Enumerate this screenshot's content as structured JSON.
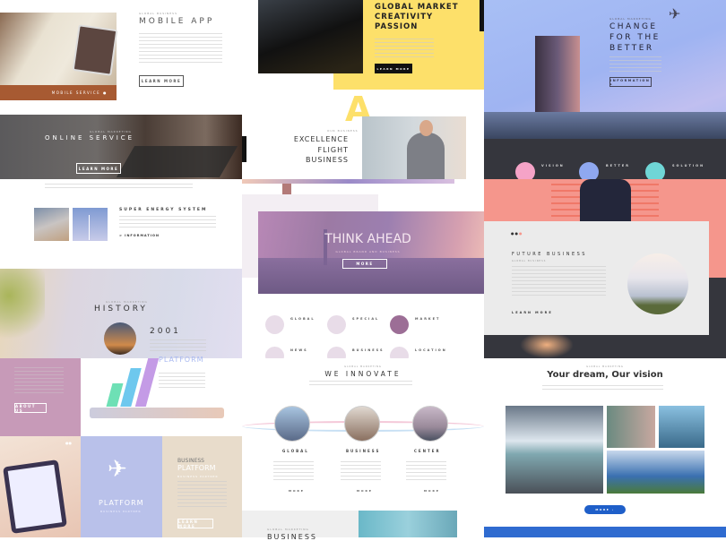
{
  "mobile_app": {
    "kicker": "GLOBAL BUSINESS",
    "title": "MOBILE APP",
    "button": "LEARN MORE",
    "bar_label": "MOBILE SERVICE",
    "bar_color": "#a75a32"
  },
  "online_service": {
    "kicker": "GLOBAL MARKETING",
    "title": "ONLINE SERVICE",
    "button": "LEARN MORE"
  },
  "energy": {
    "title": "SUPER ENERGY SYSTEM",
    "link": "> INFORMATION"
  },
  "history": {
    "kicker": "GLOBAL MARKETING",
    "title": "HISTORY",
    "year": "2001"
  },
  "about": {
    "button": "ABOUT US",
    "color": "#c79ab8"
  },
  "platform_chart": {
    "title": "PLATFORM"
  },
  "platform_plane": {
    "title": "PLATFORM",
    "subtitle": "BUSINESS PARTNER",
    "color": "#b9c1ea"
  },
  "business_platform": {
    "line1": "BUSINESS",
    "line2": "PLATFORM",
    "subtitle": "BUSINESS PARTNER",
    "button": "LEARN MORE",
    "color": "#e8dccb"
  },
  "global_market": {
    "lines": [
      "GLOBAL MARKET",
      "CREATIVITY",
      "PASSION"
    ],
    "button": "LEARN MORE",
    "color": "#fde06a"
  },
  "excellence": {
    "letter": "A",
    "kicker": "OUR BUSINESS",
    "lines": [
      "EXCELLENCE",
      "FLIGHT",
      "BUSINESS"
    ]
  },
  "think_ahead": {
    "title": "THINK AHEAD",
    "subtitle": "GLOBAL BRAND AND BUSINESS",
    "button": "MORE"
  },
  "features": [
    {
      "label": "GLOBAL",
      "icon": "monitor-icon"
    },
    {
      "label": "SPECIAL",
      "icon": "gear-icon"
    },
    {
      "label": "MARKET",
      "icon": "book-icon"
    },
    {
      "label": "NEWS",
      "icon": "star-icon"
    },
    {
      "label": "BUSINESS",
      "icon": "bag-icon"
    },
    {
      "label": "LOCATION",
      "icon": "map-icon"
    }
  ],
  "innovate": {
    "kicker": "GLOBAL MARKETING",
    "title": "WE INNOVATE",
    "items": [
      {
        "label": "GLOBAL",
        "more": "MORE"
      },
      {
        "label": "BUSINESS",
        "more": "MORE"
      },
      {
        "label": "CENTER",
        "more": "MORE"
      }
    ]
  },
  "bottom_business": {
    "kicker": "GLOBAL MARKETING",
    "title": "BUSINESS"
  },
  "change": {
    "kicker": "GLOBAL MARKETING",
    "lines": [
      "CHANGE",
      "FOR THE",
      "BETTER"
    ],
    "button": "INFORMATION ▸"
  },
  "values": [
    {
      "label": "VISION",
      "color": "#f5a3c7"
    },
    {
      "label": "BETTER",
      "color": "#8fa8f0"
    },
    {
      "label": "SOLUTION",
      "color": "#6fd6d6"
    }
  ],
  "future": {
    "title": "FUTURE BUSINESS",
    "kicker": "GLOBAL BUSINESS",
    "link": "LEARN MORE",
    "accent": "#f5968c"
  },
  "vision": {
    "kicker": "GLOBAL MARKETING",
    "title": "Your dream, Our vision",
    "button": "MORE ›",
    "accent": "#1f5fc9"
  }
}
